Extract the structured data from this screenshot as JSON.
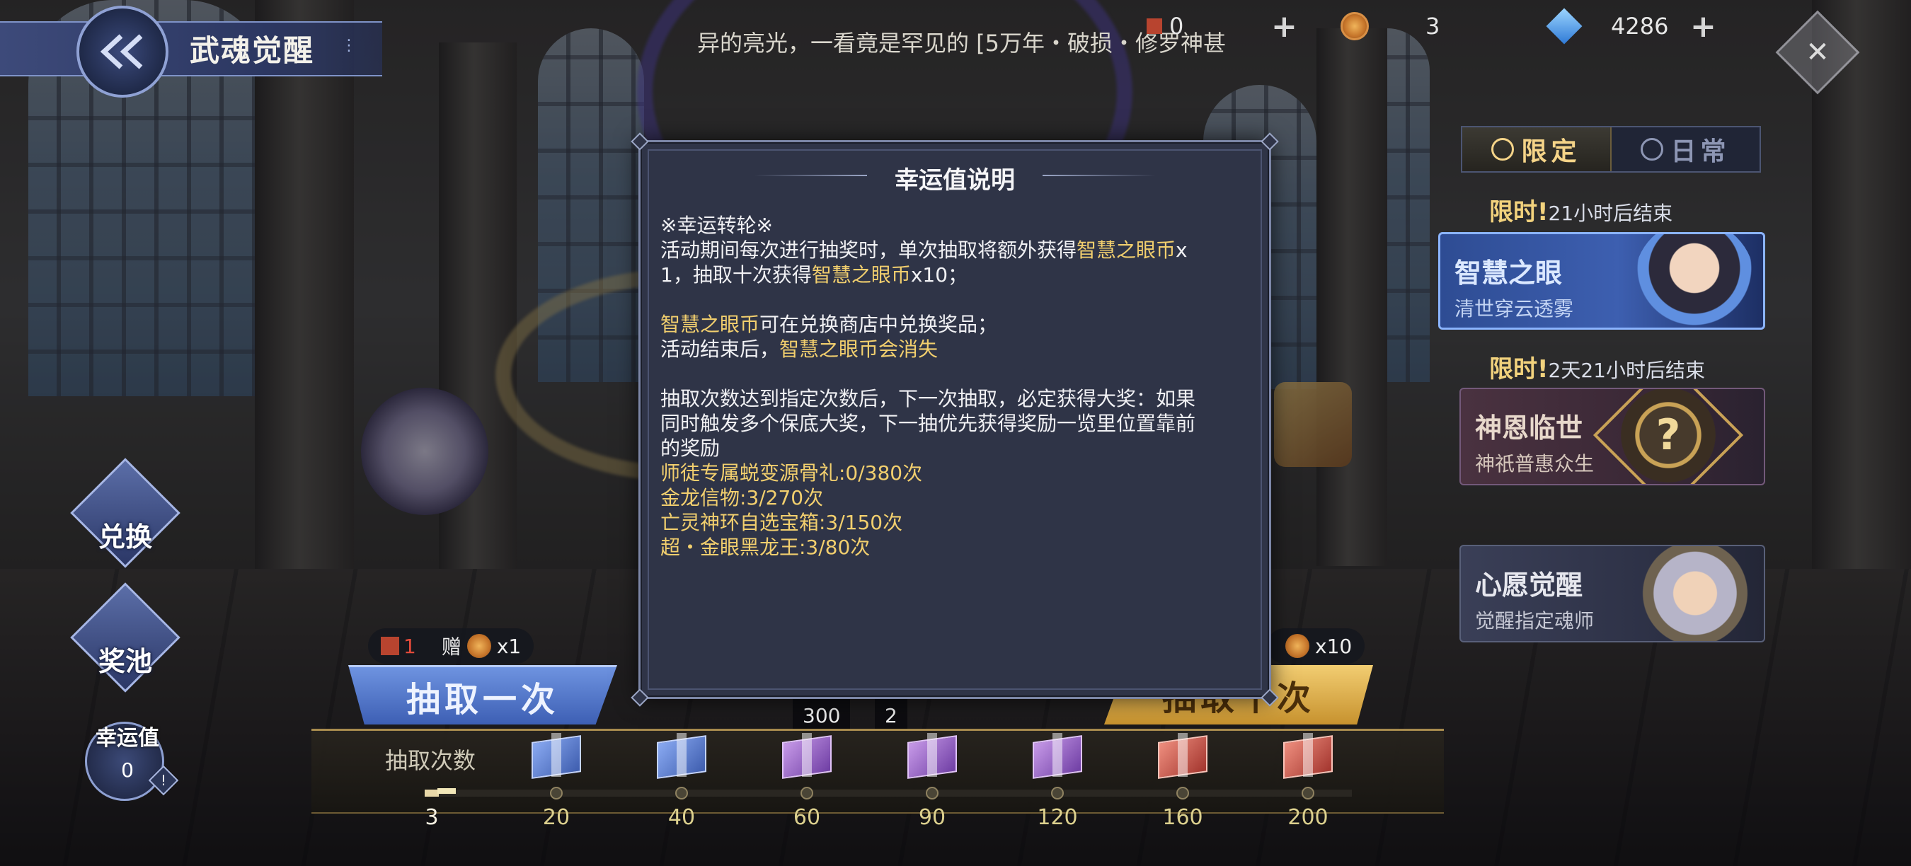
{
  "header": {
    "title": "武魂觉醒",
    "info_icon": "⋮",
    "marquee": "异的亮光，一看竟是罕见的 [5万年・破损・修罗神甚"
  },
  "resources": [
    {
      "icon": "ticket-icon",
      "value": "0"
    },
    {
      "icon": "coin-icon",
      "value": "3"
    },
    {
      "icon": "gem-icon",
      "value": "4286"
    }
  ],
  "right_panel": {
    "tabs": [
      {
        "label": "限定",
        "active": true
      },
      {
        "label": "日常",
        "active": false
      }
    ],
    "events": [
      {
        "limit_prefix": "限时!",
        "limit_text": "21小时后结束",
        "title": "智慧之眼",
        "subtitle": "清世穿云透雾"
      },
      {
        "limit_prefix": "限时!",
        "limit_text": "2天21小时后结束",
        "title": "神恩临世",
        "subtitle": "神祇普惠众生",
        "badge": "?"
      },
      {
        "title": "心愿觉醒",
        "subtitle": "觉醒指定魂师"
      }
    ]
  },
  "left_menu": {
    "exchange_label": "兑换",
    "pool_label": "奖池",
    "luck_label": "幸运值",
    "luck_value": "0",
    "luck_warn": "!"
  },
  "draw": {
    "gift_once_prefix": "赠",
    "gift_once_count": "x1",
    "gift_once_left": "1",
    "gift_ten_count": "x10",
    "once_label": "抽取一次",
    "ten_label": "抽取十次",
    "cost_badge_1": "300",
    "cost_badge_2": "2"
  },
  "progress": {
    "label": "抽取次数",
    "current": 3,
    "current_text": "3",
    "milestones": [
      {
        "value": "20",
        "box": "blue"
      },
      {
        "value": "40",
        "box": "blue"
      },
      {
        "value": "60",
        "box": "purple"
      },
      {
        "value": "90",
        "box": "purple"
      },
      {
        "value": "120",
        "box": "purple"
      },
      {
        "value": "160",
        "box": "red"
      },
      {
        "value": "200",
        "box": "red"
      }
    ]
  },
  "modal": {
    "title": "幸运值说明",
    "section_title": "※幸运转轮※",
    "line1_a": "活动期间每次进行抽奖时，单次抽取将额外获得",
    "line1_b": "智慧之眼币",
    "line1_c": "x",
    "line2_a": "1，抽取十次获得",
    "line2_b": "智慧之眼币",
    "line2_c": "x10；",
    "line3_a": "智慧之眼币",
    "line3_b": "可在兑换商店中兑换奖品；",
    "line4_a": "活动结束后，",
    "line4_b": "智慧之眼币会消失",
    "line5": "抽取次数达到指定次数后，下一次抽取，必定获得大奖：如果",
    "line6": "同时触发多个保底大奖，下一抽优先获得奖励一览里位置靠前",
    "line7": "的奖励",
    "rewards": [
      "师徒专属蜕变源骨礼:0/380次",
      "金龙信物:3/270次",
      "亡灵神环自选宝箱:3/150次",
      "超・金眼黑龙王:3/80次"
    ]
  },
  "colors": {
    "highlight": "#f2cf6e",
    "modal_bg": "#2f3447",
    "accent_blue": "#3d5fb4",
    "accent_gold": "#c7922e"
  }
}
